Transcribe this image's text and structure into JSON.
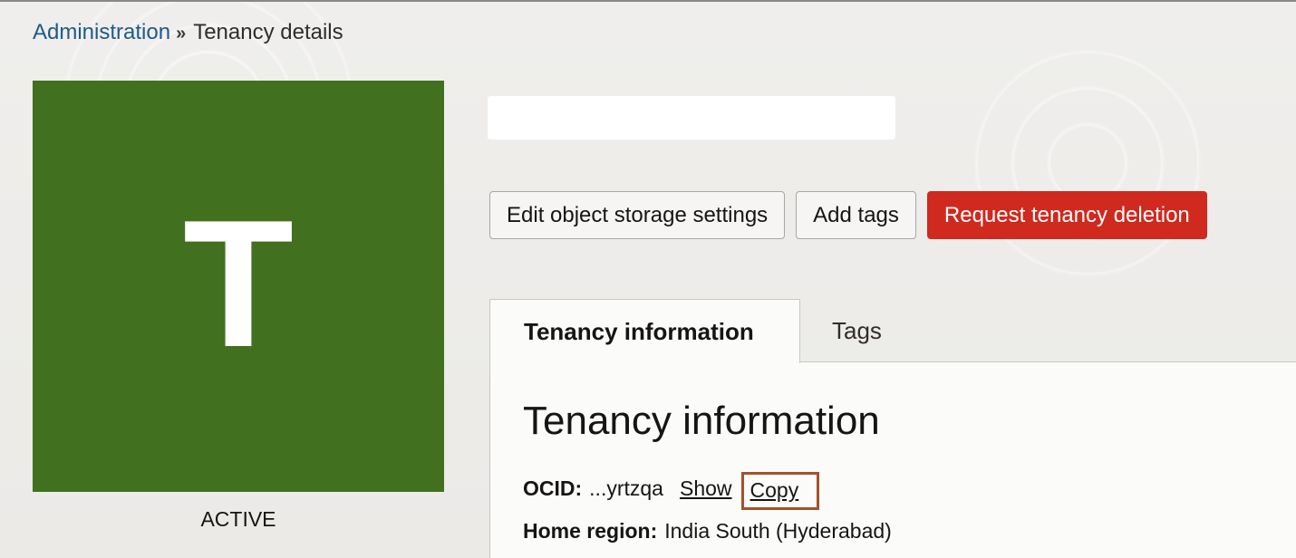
{
  "breadcrumb": {
    "parent": "Administration",
    "separator": "»",
    "current": "Tenancy details"
  },
  "avatar": {
    "letter": "T",
    "color": "#41711e"
  },
  "status": "ACTIVE",
  "actions": {
    "edit_storage": "Edit object storage settings",
    "add_tags": "Add tags",
    "request_deletion": "Request tenancy deletion"
  },
  "tabs": [
    {
      "label": "Tenancy information",
      "active": true
    },
    {
      "label": "Tags",
      "active": false
    }
  ],
  "panel": {
    "title": "Tenancy information",
    "ocid_label": "OCID:",
    "ocid_value": "...yrtzqa",
    "show_link": "Show",
    "copy_link": "Copy",
    "region_label": "Home region:",
    "region_value": "India South (Hyderabad)"
  },
  "colors": {
    "danger": "#d0291e",
    "link": "#1f5a8a",
    "highlight": "#a3522a"
  }
}
